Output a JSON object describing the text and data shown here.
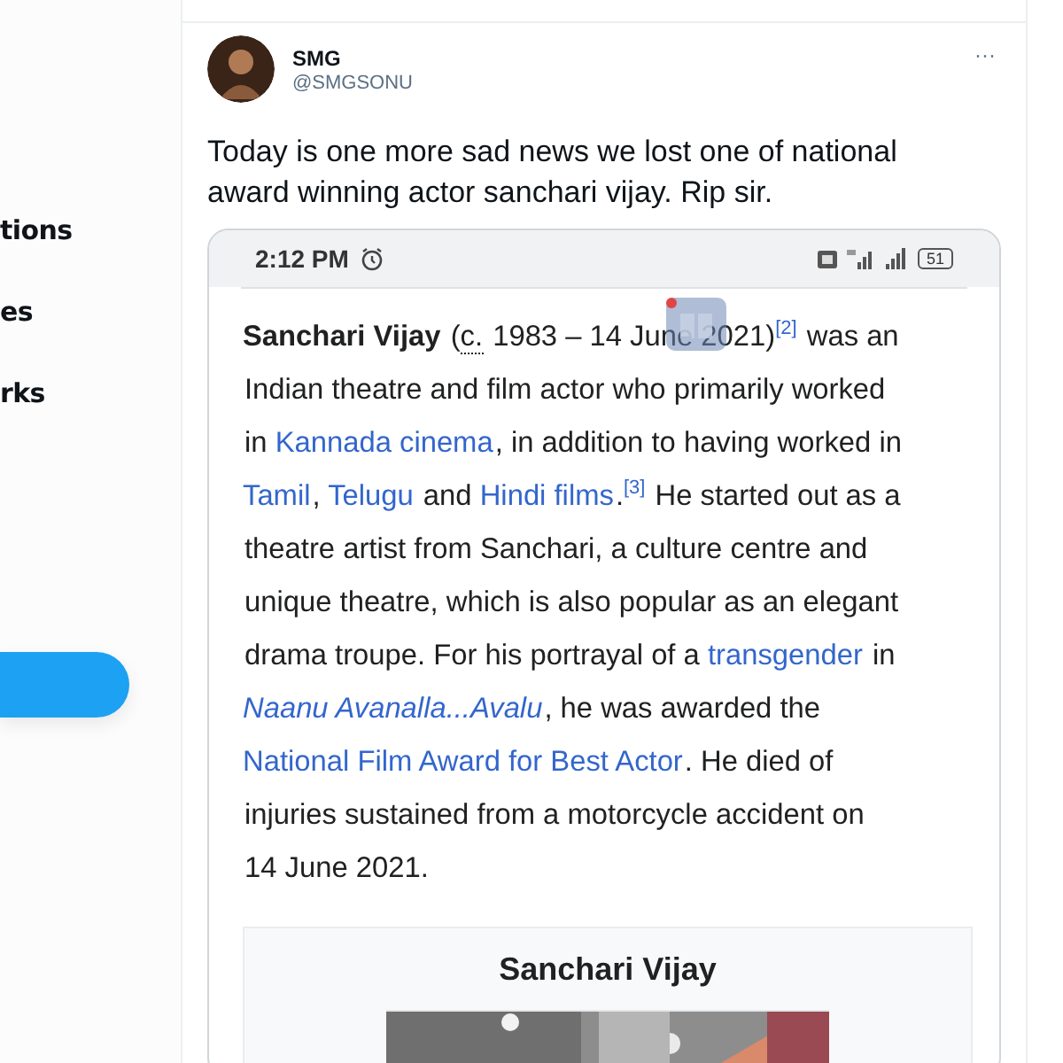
{
  "sidebar": {
    "items": [
      {
        "label": "tions"
      },
      {
        "label": "es"
      },
      {
        "label": "rks"
      }
    ],
    "button": {
      "kind": "primary"
    }
  },
  "tweet": {
    "author": {
      "name": "SMG",
      "handle": "@SMGSONU"
    },
    "menu": "···",
    "text": "Today is one more sad news we lost one of national award winning actor sanchari vijay. Rip sir.",
    "screenshot": {
      "status_bar": {
        "time": "2:12 PM",
        "battery": "51"
      },
      "article_lines": [
        [
          {
            "kind": "bold",
            "text": "Sanchari Vijay"
          },
          {
            "kind": "plain",
            "text": " ("
          },
          {
            "kind": "abbr",
            "text": "c."
          },
          {
            "kind": "plain",
            "text": " 1983 – 14 June 2021)"
          },
          {
            "kind": "sup",
            "text": "[2]"
          },
          {
            "kind": "plain",
            "text": " was an"
          }
        ],
        [
          {
            "kind": "plain",
            "text": "Indian theatre and film actor who primarily worked"
          }
        ],
        [
          {
            "kind": "plain",
            "text": "in "
          },
          {
            "kind": "link",
            "text": "Kannada cinema"
          },
          {
            "kind": "plain",
            "text": ", in addition to having worked in"
          }
        ],
        [
          {
            "kind": "link",
            "text": "Tamil",
            "tail": ", "
          },
          {
            "kind": "link",
            "text": "Telugu"
          },
          {
            "kind": "plain",
            "text": " and "
          },
          {
            "kind": "link",
            "text": "Hindi films",
            "tail": "."
          },
          {
            "kind": "sup",
            "text": "[3]"
          },
          {
            "kind": "plain",
            "text": " He started out as a"
          }
        ],
        [
          {
            "kind": "plain",
            "text": "theatre artist from Sanchari, a culture centre and"
          }
        ],
        [
          {
            "kind": "plain",
            "text": "unique theatre, which is also popular as an elegant"
          }
        ],
        [
          {
            "kind": "plain",
            "text": "drama troupe. For his portrayal of a "
          },
          {
            "kind": "link",
            "text": "transgender"
          },
          {
            "kind": "plain",
            "text": " in"
          }
        ],
        [
          {
            "kind": "italic_link",
            "text": "Naanu Avanalla...Avalu"
          },
          {
            "kind": "plain",
            "text": ", he was awarded the"
          }
        ],
        [
          {
            "kind": "link",
            "text": "National Film Award for Best Actor"
          },
          {
            "kind": "plain",
            "text": ". He died of"
          }
        ],
        [
          {
            "kind": "plain",
            "text": "injuries sustained from a motorcycle accident on"
          }
        ],
        [
          {
            "kind": "plain",
            "text": "14 June 2021."
          }
        ]
      ],
      "infobox": {
        "title": "Sanchari Vijay"
      }
    }
  }
}
